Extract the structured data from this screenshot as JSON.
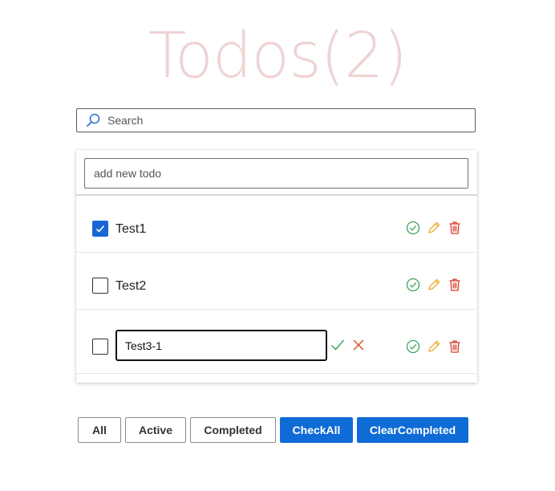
{
  "header": {
    "title": "Todos(2)"
  },
  "search": {
    "placeholder": "Search"
  },
  "new_todo": {
    "placeholder": "add new todo"
  },
  "todos": [
    {
      "label": "Test1",
      "checked": true
    },
    {
      "label": "Test2",
      "checked": false
    },
    {
      "label": "",
      "checked": false,
      "editing": true,
      "edit_value": "Test3-1"
    }
  ],
  "filters": {
    "all": "All",
    "active": "Active",
    "completed": "Completed",
    "check_all": "CheckAll",
    "clear_completed": "ClearCompleted"
  },
  "colors": {
    "title": "#efd3d3",
    "primary": "#0f6cd6",
    "complete_icon": "#3aa55d",
    "edit_icon": "#f0a92c",
    "delete_icon": "#d83b2c",
    "cancel_icon": "#d9532f"
  },
  "icons": {
    "search": "search-icon",
    "complete": "circle-check-icon",
    "edit": "pencil-icon",
    "delete": "trash-icon",
    "confirm": "checkmark-icon",
    "cancel": "close-icon"
  }
}
